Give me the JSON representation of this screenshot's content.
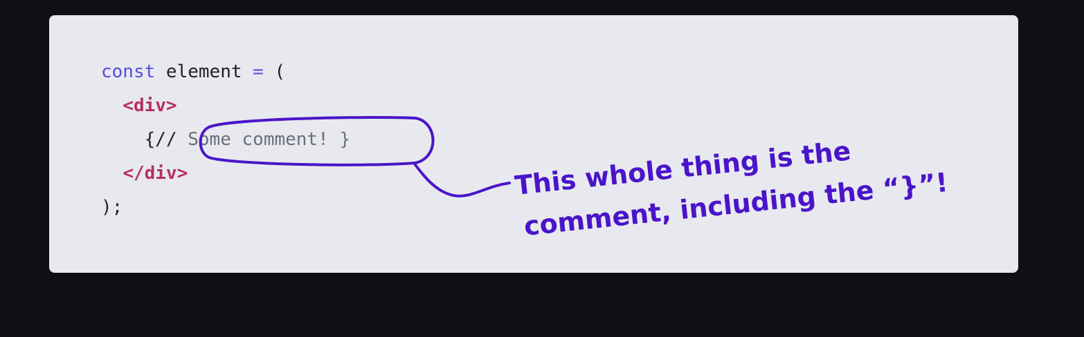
{
  "code": {
    "line1": {
      "kw": "const",
      "name": " element ",
      "op": "=",
      "rest": " ("
    },
    "line2": {
      "indent": "  ",
      "tag": "<div>"
    },
    "line3": {
      "indent": "    ",
      "open": "{//",
      "comment": " Some comment! }"
    },
    "line4": {
      "indent": "  ",
      "tag": "</div>"
    },
    "line5": {
      "text": ");"
    }
  },
  "annotation": {
    "line1": "This whole thing is the",
    "line2": "comment, including the “}”!",
    "color": "#4a14c9"
  }
}
